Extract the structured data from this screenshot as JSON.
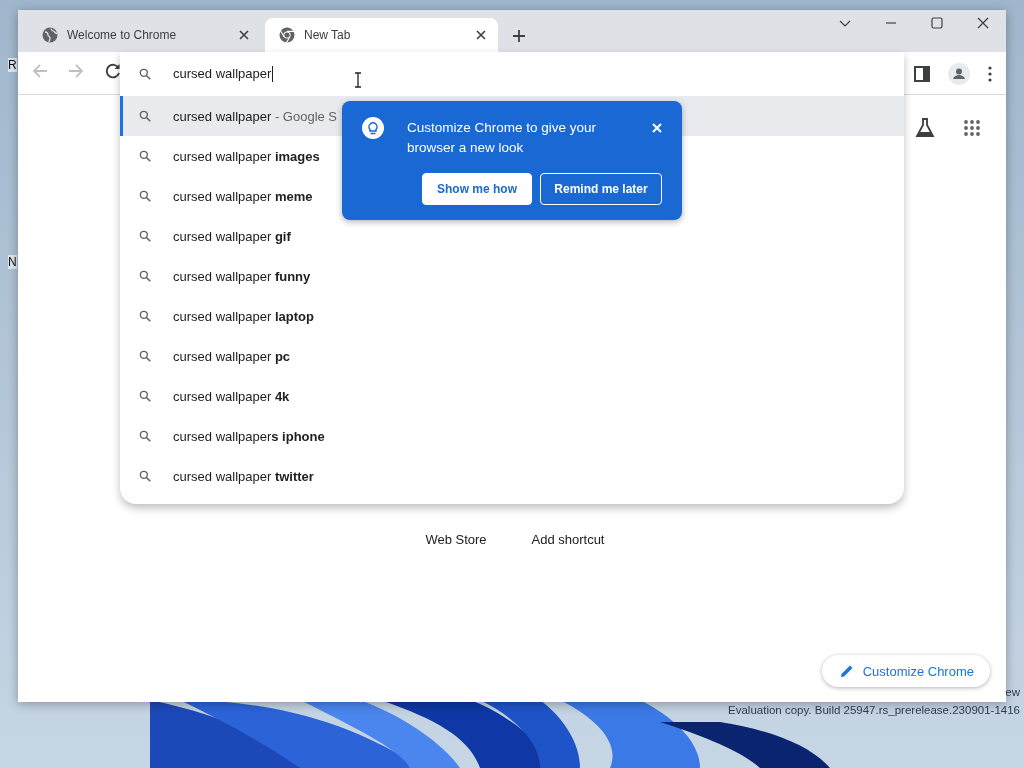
{
  "desktop": {
    "icon_labels": [
      "R",
      "N"
    ],
    "watermark": [
      "ew",
      "Evaluation copy. Build 25947.rs_prerelease.230901-1416"
    ]
  },
  "tabs": [
    {
      "title": "Welcome to Chrome",
      "selected": false
    },
    {
      "title": "New Tab",
      "selected": true
    }
  ],
  "omnibox": {
    "value": "cursed wallpaper"
  },
  "suggestions": [
    {
      "text": "cursed wallpaper",
      "hint": "- Google S",
      "selected": true
    },
    {
      "text": "cursed wallpaper **images**",
      "selected": false
    },
    {
      "text": "cursed wallpaper **meme**",
      "selected": false
    },
    {
      "text": "cursed wallpaper **gif**",
      "selected": false
    },
    {
      "text": "cursed wallpaper **funny**",
      "selected": false
    },
    {
      "text": "cursed wallpaper **laptop**",
      "selected": false
    },
    {
      "text": "cursed wallpaper **pc**",
      "selected": false
    },
    {
      "text": "cursed wallpaper **4k**",
      "selected": false
    },
    {
      "text": "cursed wallpaper**s iphone**",
      "selected": false
    },
    {
      "text": "cursed wallpaper **twitter**",
      "selected": false
    }
  ],
  "promo": {
    "message": "Customize Chrome to give your browser a new look",
    "buttons": [
      {
        "label": "Show me how",
        "kind": "filled"
      },
      {
        "label": "Remind me later",
        "kind": "outlined"
      }
    ]
  },
  "shortcuts": [
    {
      "label": "Web Store"
    },
    {
      "label": "Add shortcut"
    }
  ],
  "customize_button": "Customize Chrome"
}
